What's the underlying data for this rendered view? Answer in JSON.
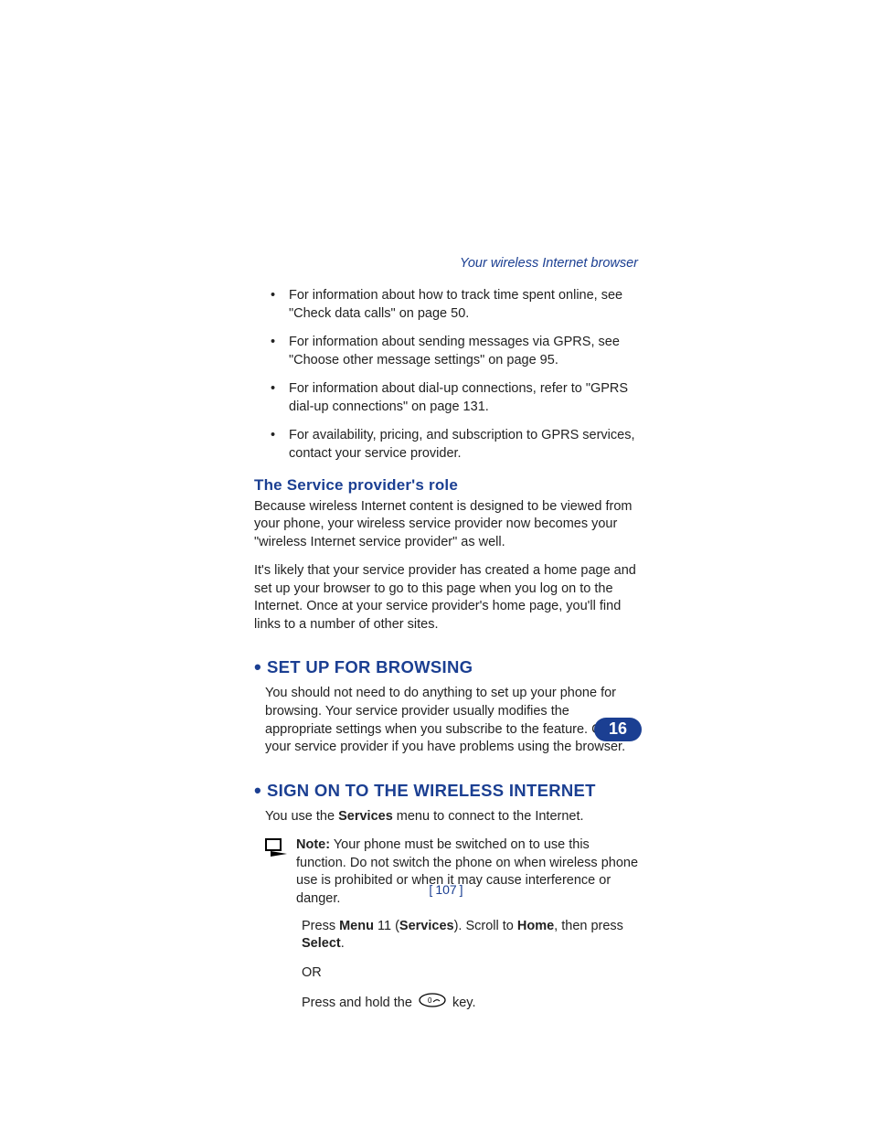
{
  "running_head": "Your wireless Internet browser",
  "bullets": [
    "For information about how to track time spent online, see \"Check data calls\" on page 50.",
    "For information about sending messages via GPRS, see \"Choose other message settings\" on page 95.",
    "For information about dial-up connections, refer to \"GPRS dial-up connections\" on page 131.",
    "For availability, pricing, and subscription to GPRS services, contact your service provider."
  ],
  "subhead1": "The Service provider's role",
  "sp_p1": "Because wireless Internet content is designed to be viewed from your phone, your wireless service provider now becomes your \"wireless Internet service provider\" as well.",
  "sp_p2": "It's likely that your service provider has created a home page and set up your browser to go to this page when you log on to the Internet. Once at your service provider's home page, you'll find links to a number of other sites.",
  "section1": "SET UP FOR BROWSING",
  "setup_p1": "You should not need to do anything to set up your phone for browsing. Your service provider usually modifies the appropriate settings when you subscribe to the feature. Contact your service provider if you have problems using the browser.",
  "section2": "SIGN ON TO THE WIRELESS INTERNET",
  "signon_intro_pre": "You use the ",
  "signon_intro_bold": "Services",
  "signon_intro_post": " menu to connect to the Internet.",
  "note_label": "Note:",
  "note_text": " Your phone must be switched on to use this function. Do not switch the phone on when wireless phone use is prohibited or when it may cause interference or danger.",
  "step_press": "Press ",
  "step_menu": "Menu",
  "step_11": " 11 (",
  "step_services": "Services",
  "step_scroll": "). Scroll to ",
  "step_home": "Home",
  "step_then": ", then press ",
  "step_select": "Select",
  "step_period": ".",
  "or_text": "OR",
  "hold_pre": "Press and hold the ",
  "hold_post": " key.",
  "page_number": "107",
  "chapter_number": "16"
}
